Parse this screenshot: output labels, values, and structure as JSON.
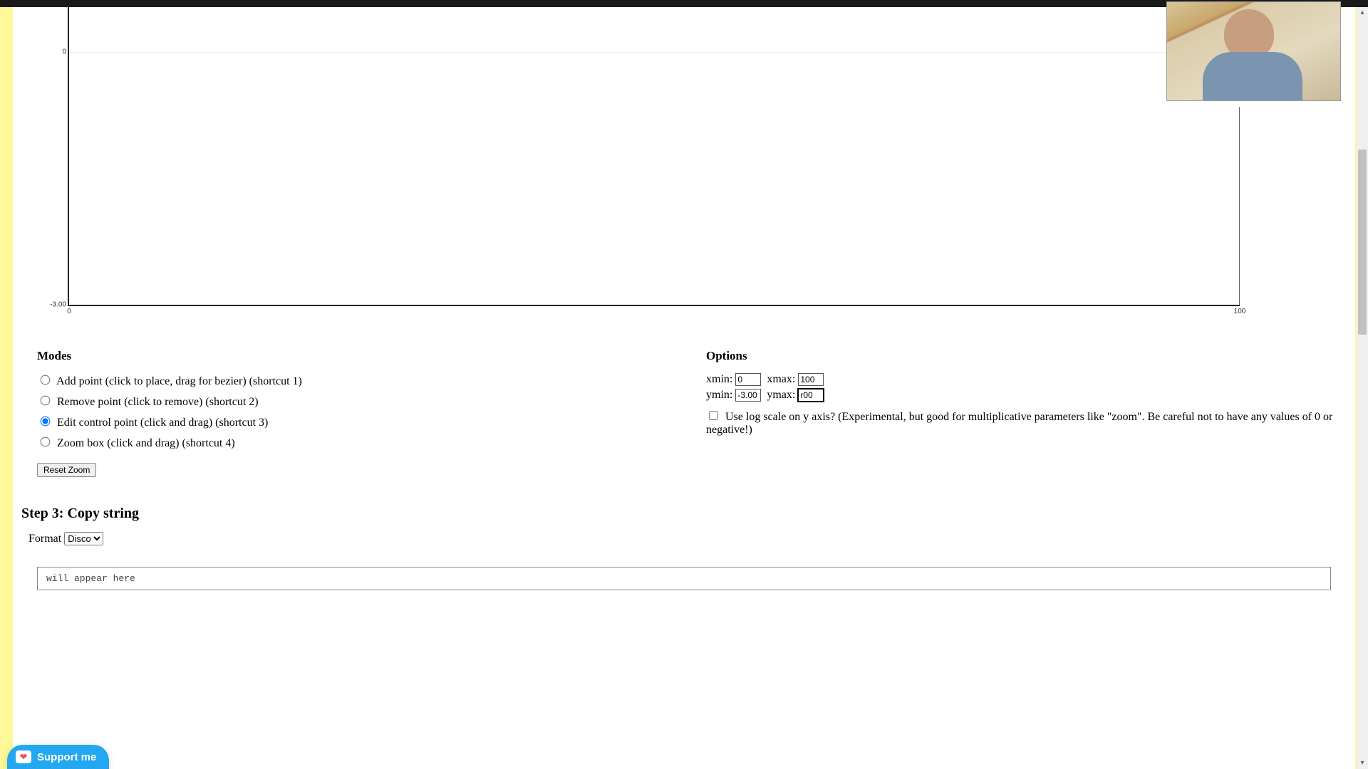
{
  "plot": {
    "y_ticks": [
      "0",
      "-3.00"
    ],
    "x_ticks": [
      "0",
      "100"
    ]
  },
  "modes": {
    "heading": "Modes",
    "items": [
      {
        "label": "Add point (click to place, drag for bezier) (shortcut 1)",
        "checked": false
      },
      {
        "label": "Remove point (click to remove) (shortcut 2)",
        "checked": false
      },
      {
        "label": "Edit control point (click and drag) (shortcut 3)",
        "checked": true
      },
      {
        "label": "Zoom box (click and drag) (shortcut 4)",
        "checked": false
      }
    ],
    "reset_label": "Reset Zoom"
  },
  "options": {
    "heading": "Options",
    "xmin_label": "xmin:",
    "xmin_value": "0",
    "xmax_label": "xmax:",
    "xmax_value": "100",
    "ymin_label": "ymin:",
    "ymin_value": "-3.00",
    "ymax_label": "ymax:",
    "ymax_value": "r00",
    "log_label": "Use log scale on y axis? (Experimental, but good for multiplicative parameters like \"zoom\". Be careful not to have any values of 0 or negative!)",
    "log_checked": false
  },
  "step3": {
    "heading": "Step 3: Copy string",
    "format_label": "Format",
    "format_selected": "Disco",
    "output_placeholder": "will appear here"
  },
  "support": {
    "label": "Support me"
  },
  "chart_data": {
    "type": "line",
    "title": "",
    "xlabel": "",
    "ylabel": "",
    "xlim": [
      0,
      100
    ],
    "ylim": [
      -3.0,
      0
    ],
    "series": []
  }
}
